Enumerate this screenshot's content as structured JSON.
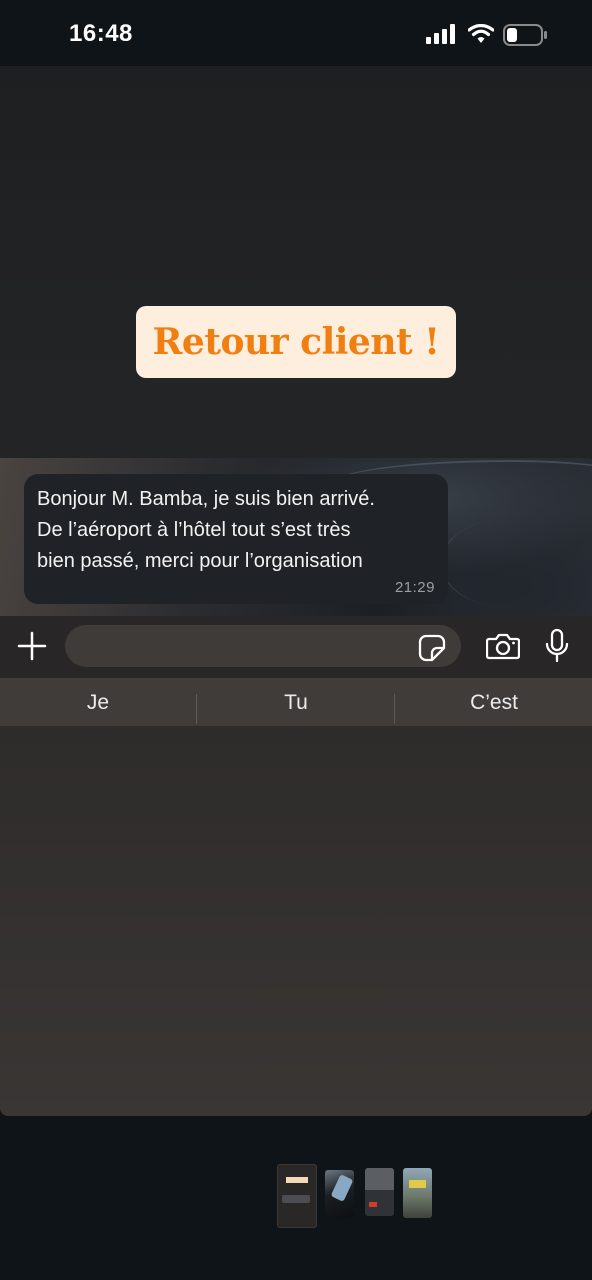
{
  "status_bar": {
    "time": "16:48",
    "icons": [
      "cellular-signal-icon",
      "wifi-icon",
      "battery-icon"
    ]
  },
  "story": {
    "headline": "Retour client !",
    "headline_color": "#f07f12",
    "headline_bg": "#fdeede"
  },
  "message": {
    "lines": [
      "Bonjour M. Bamba, je suis bien arrivé.",
      "De l’aéroport à l’hôtel tout s’est très",
      "bien passé, merci pour l’organisation"
    ],
    "time": "21:29"
  },
  "input_bar": {
    "placeholder": "",
    "icons": [
      "plus-icon",
      "sticker-icon",
      "camera-icon",
      "microphone-icon"
    ]
  },
  "suggestions": [
    "Je",
    "Tu",
    "C’est"
  ],
  "thumbnails": [
    "story-thumbnail-1",
    "story-thumbnail-2",
    "story-thumbnail-3",
    "story-thumbnail-4"
  ]
}
